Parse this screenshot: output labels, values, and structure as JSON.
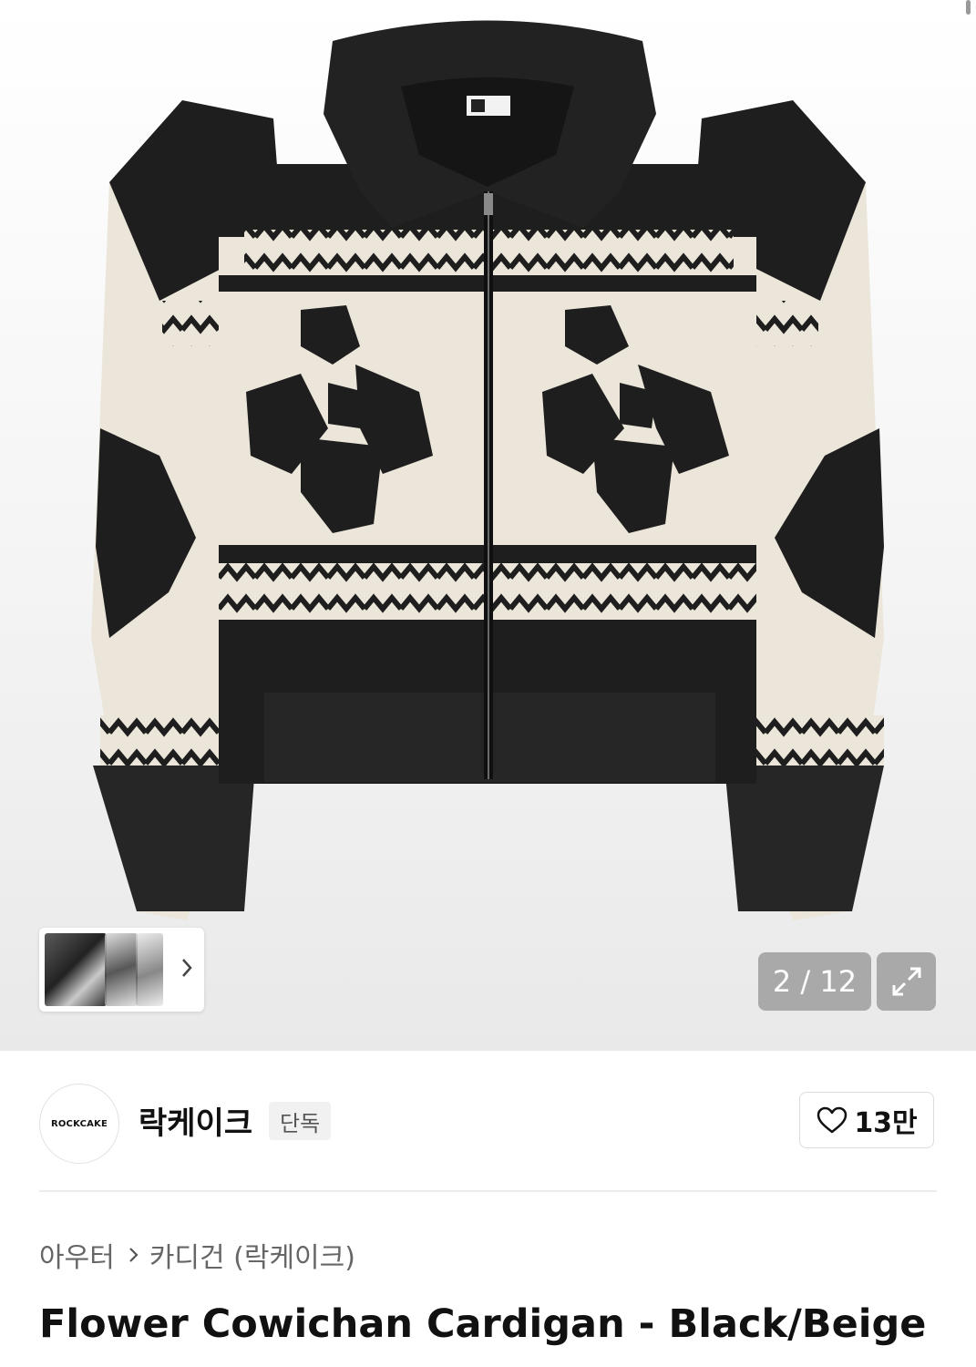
{
  "gallery": {
    "page_counter": "2 / 12",
    "image_alt": "Flower Cowichan Cardigan - Black/Beige"
  },
  "brand": {
    "logo_text": "ROCKCAKE",
    "name": "락케이크",
    "badge": "단독",
    "like_count": "13만"
  },
  "breadcrumb": {
    "items": [
      "아우터",
      "카디건 (락케이크)"
    ]
  },
  "product": {
    "title": "Flower Cowichan Cardigan - Black/Beige"
  },
  "colors": {
    "knit_black": "#1e1e1e",
    "knit_beige": "#ece6da",
    "overlay_gray": "#969696"
  }
}
